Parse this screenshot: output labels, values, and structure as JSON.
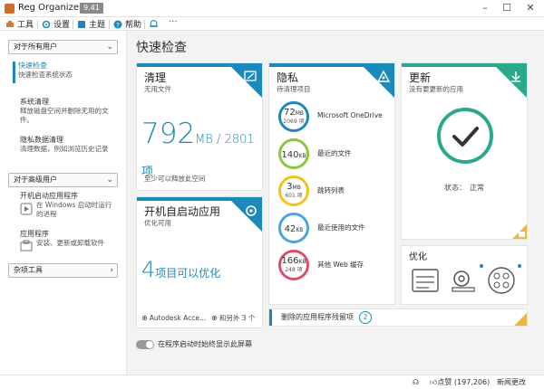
{
  "app": {
    "title": "Reg Organizer",
    "version": "9.41"
  },
  "menubar": {
    "items": [
      {
        "label": "工具"
      },
      {
        "label": "设置"
      },
      {
        "label": "主题"
      },
      {
        "label": "帮助"
      }
    ]
  },
  "sidebar": {
    "sections": [
      {
        "label": "对于所有用户"
      },
      {
        "label": "对于高级用户"
      },
      {
        "label": "杂项工具"
      }
    ],
    "items": [
      {
        "title": "快速检查",
        "desc": "快速检查系统状态"
      },
      {
        "title": "系统清理",
        "desc": "释放磁盘空间并删除无用的文件。"
      },
      {
        "title": "隐私数据清理",
        "desc": "清理数据，例如浏览历史记录"
      },
      {
        "title": "开机启动应用程序",
        "desc": "在 Windows 启动时运行的进程"
      },
      {
        "title": "应用程序",
        "desc": "安装、更新或卸载软件"
      }
    ],
    "toggle_label": "在程序启动时始终显示此屏幕"
  },
  "main": {
    "title": "快速检查",
    "clean": {
      "title": "清理",
      "subtitle": "无用文件",
      "value": "792",
      "unit": "MB / 2801 项",
      "footer": "至少可以释放此空间"
    },
    "startup": {
      "title": "开机自启动应用",
      "subtitle": "优化可用",
      "value": "4",
      "unit": "项目可以优化",
      "app_name": "Autodesk Acce...",
      "more": "和另外 3 个"
    },
    "privacy": {
      "title": "隐私",
      "subtitle": "待清理项目",
      "rows": [
        {
          "value": "72",
          "unit": "MB",
          "count": "2069 项",
          "label": "Microsoft OneDrive",
          "color": "#1c8ab8"
        },
        {
          "value": "140",
          "unit": "KB",
          "count": "",
          "label": "最近的文件",
          "color": "#8cc63f"
        },
        {
          "value": "3",
          "unit": "MB",
          "count": "601 项",
          "label": "跳转列表",
          "color": "#f0c419"
        },
        {
          "value": "42",
          "unit": "KB",
          "count": "",
          "label": "最近使用的文件",
          "color": "#4aa8d8"
        },
        {
          "value": "166",
          "unit": "KB",
          "count": "248 项",
          "label": "其他 Web 缓存",
          "color": "#e04c6c"
        }
      ]
    },
    "update": {
      "title": "更新",
      "subtitle": "没有要更新的应用",
      "status_label": "状态：",
      "status_value": "正常"
    },
    "optimize": {
      "title": "优化"
    },
    "removed": {
      "label": "删除的应用程序残留项",
      "count": "2"
    }
  },
  "statusbar": {
    "like_label": "点赞 (197,206)",
    "news_label": "新闻更改"
  },
  "colors": {
    "accent": "#1c8ab8",
    "green": "#2aa98b",
    "lock": "#e8b93a"
  }
}
